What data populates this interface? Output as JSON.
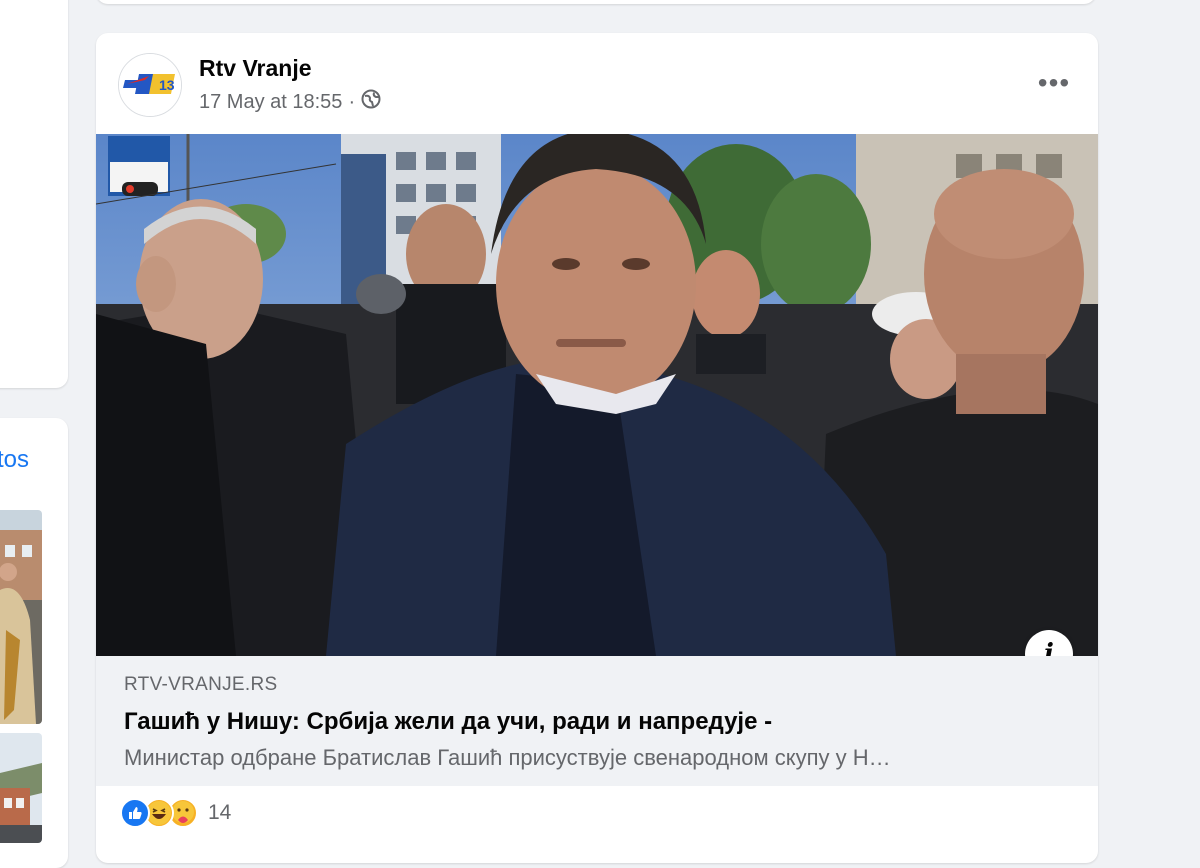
{
  "feed": {
    "side_link": "tos"
  },
  "post": {
    "page_name": "Rtv Vranje",
    "timestamp": "17 May at 18:55",
    "separator": "·",
    "privacy_icon": "globe-icon",
    "more_icon": "more-options-icon",
    "more_label": "•••",
    "avatar_logo": "RTV Vranje logo",
    "link": {
      "domain": "RTV-VRANJE.RS",
      "title": "Гашић у Нишу: Србија жели да учи, ради и напредује -",
      "description": "Министар одбране Братислав Гашић присуствује свенародном скупу у Н…",
      "info_label": "i"
    },
    "reactions": {
      "types": [
        "like-icon",
        "haha-icon",
        "care-icon"
      ],
      "count": "14"
    }
  },
  "colors": {
    "accent": "#1877f2",
    "background": "#f0f2f5",
    "secondary_text": "#65676b"
  }
}
